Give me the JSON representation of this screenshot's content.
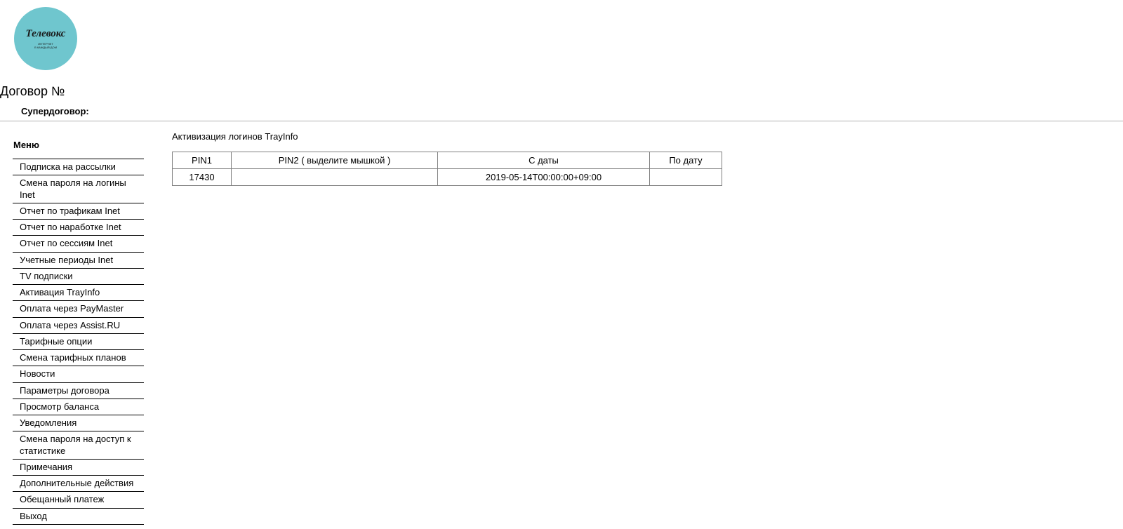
{
  "logo": {
    "brand": "Телевокс",
    "tagline1": "ИНТЕРНЕТ",
    "tagline2": "В КАЖДЫЙ ДОМ"
  },
  "header": {
    "contract_label": "Договор №",
    "super_label": "Супердоговор:"
  },
  "menu": {
    "title": "Меню",
    "items": [
      "Подписка на рассылки",
      "Смена пароля на логины Inet",
      "Отчет по трафикам Inet",
      "Отчет по наработке Inet",
      "Отчет по сессиям Inet",
      "Учетные периоды Inet",
      "TV подписки",
      "Активация TrayInfo",
      "Оплата через PayMaster",
      "Оплата через Assist.RU",
      "Тарифные опции",
      "Смена тарифных планов",
      "Новости",
      "Параметры договора",
      "Просмотр баланса",
      "Уведомления",
      "Смена пароля на доступ к статистике",
      "Примечания",
      "Дополнительные действия",
      "Обещанный платеж",
      "Выход"
    ]
  },
  "content": {
    "title": "Активизация логинов TrayInfo",
    "table": {
      "headers": {
        "pin1": "PIN1",
        "pin2": "PIN2 ( выделите мышкой )",
        "from": "С даты",
        "to": "По дату"
      },
      "rows": [
        {
          "pin1": "17430",
          "pin2": "",
          "from": "2019-05-14T00:00:00+09:00",
          "to": ""
        }
      ]
    }
  }
}
